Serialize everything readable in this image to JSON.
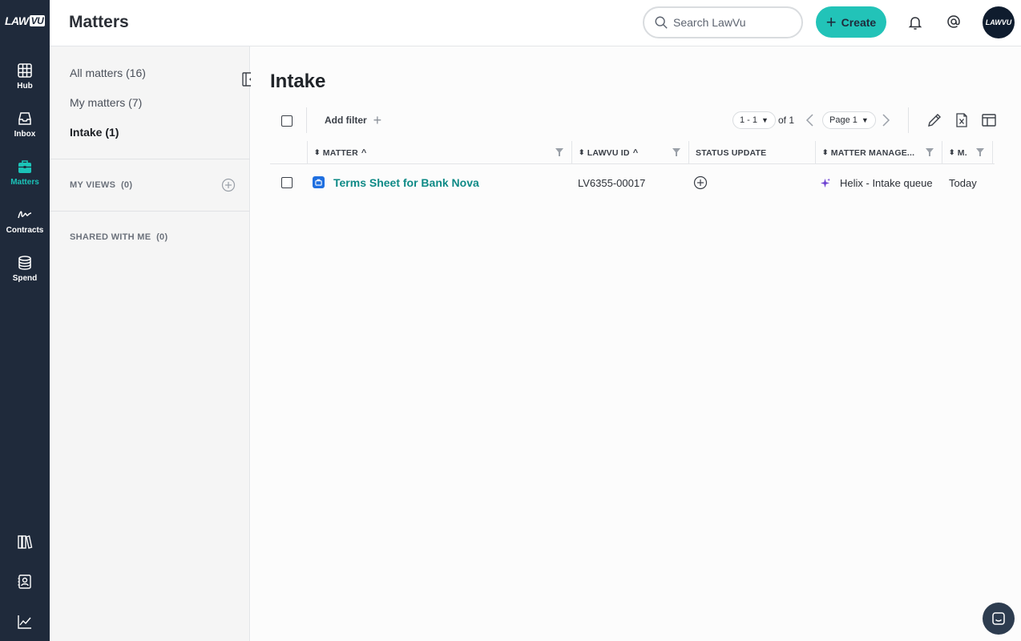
{
  "app": {
    "logo_text_a": "LAW",
    "logo_text_b": "VU"
  },
  "nav": {
    "items": [
      {
        "label": "Hub",
        "icon": "grid-icon"
      },
      {
        "label": "Inbox",
        "icon": "inbox-icon"
      },
      {
        "label": "Matters",
        "icon": "briefcase-icon",
        "active": true
      },
      {
        "label": "Contracts",
        "icon": "signature-icon"
      },
      {
        "label": "Spend",
        "icon": "coins-icon"
      }
    ],
    "bottom_icons": [
      "library-icon",
      "contacts-icon",
      "reports-icon"
    ],
    "active_color": "#1bc3b8"
  },
  "header": {
    "title": "Matters",
    "search_placeholder": "Search LawVu",
    "create_label": "Create",
    "avatar_text": "LAWVU"
  },
  "views": {
    "links": [
      {
        "label": "All matters",
        "count": "(16)"
      },
      {
        "label": "My matters",
        "count": "(7)"
      },
      {
        "label": "Intake",
        "count": "(1)",
        "active": true
      }
    ],
    "my_views_label": "MY VIEWS",
    "my_views_count": "(0)",
    "shared_label": "SHARED WITH ME",
    "shared_count": "(0)"
  },
  "main": {
    "title": "Intake",
    "add_filter_label": "Add filter",
    "range_label": "1 - 1",
    "of_label": "of 1",
    "page_label": "Page 1",
    "columns": [
      "MATTER",
      "LAWVU ID",
      "STATUS UPDATE",
      "MATTER MANAGE...",
      "M."
    ],
    "rows": [
      {
        "matter": "Terms Sheet for Bank Nova",
        "lawvu_id": "LV6355-00017",
        "manager": "Helix - Intake queue",
        "modified": "Today"
      }
    ]
  },
  "colors": {
    "nav_bg": "#1f2a3b",
    "accent": "#22c3b8",
    "link": "#0e8a86",
    "matter_icon": "#1f6fe0",
    "helix_icon": "#6b3fd1"
  }
}
